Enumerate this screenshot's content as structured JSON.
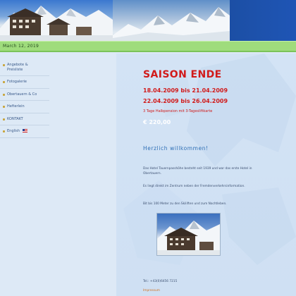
{
  "date": "March 12, 2019",
  "nav": {
    "items": [
      {
        "label": "Angebote &\nPreisliste"
      },
      {
        "label": "Fotogalerie"
      },
      {
        "label": "Obertauern & Co"
      },
      {
        "label": "Hefterlein"
      },
      {
        "label": "KONTAKT"
      },
      {
        "label": "English"
      }
    ]
  },
  "promo": {
    "title": "SAISON ENDE",
    "date_range_1": "18.04.2009 bis 21.04.2009",
    "date_range_2": "22.04.2009 bis 26.04.2009",
    "subtitle": "3 Tage Halbpension mit 3-Tagesliftkarte",
    "price": "€ 220,00"
  },
  "welcome": "Herzlich willkommen!",
  "paragraphs": [
    "Das Hotel Tauernpasshöhe besteht seit 1939 und war das erste Hotel in Obertauern.",
    "Es liegt direkt im Zentrum neben der Fremdenverkehrsinformation.",
    "Bit bis 100 Meter zu den Skiliften und zum Nachtleben."
  ],
  "footer": {
    "tel": "Tel.: +43(0)6456 7215",
    "impressum": "Impressum"
  },
  "colors": {
    "header_blue": "#2f63b6",
    "date_strip_green": "#9fdc7c",
    "promo_red": "#d11a1a",
    "welcome_blue": "#2f6fb5",
    "link_orange": "#d07020"
  }
}
